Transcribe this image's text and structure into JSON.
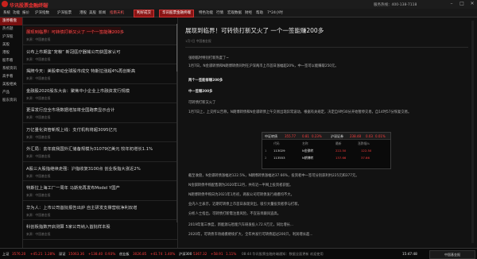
{
  "app": {
    "brand": "华讯股票金融终端",
    "brand_sub": "10.0",
    "hotline": "服务热线：400-138-7118"
  },
  "menu": {
    "items": [
      "系统",
      "功能",
      "报价",
      "沪深指数",
      "沪深股票",
      "港股",
      "美股",
      "新闻",
      "指南天机",
      "利好成交",
      "新闻"
    ],
    "highlight": "指南天机",
    "badges": [
      "利好成交",
      "华讯股票金融终端"
    ],
    "right_items": [
      "特色功能",
      "行情",
      "宏观数据",
      "财经",
      "帮助",
      "7*24小时"
    ]
  },
  "nav": {
    "items": [
      "涨停看盘",
      "热点题",
      "沪深股",
      "美股",
      "港股",
      "股市看",
      "系统资讯",
      "高手看",
      "美股相关",
      "产品",
      "股东资讯"
    ],
    "active_index": 0
  },
  "news_list": [
    {
      "title": "展现到临界！可转债打新又火了 一个一签能赚200多",
      "meta": "来源：中国基金报"
    },
    {
      "title": "公布上市期鉴“宠粮” 新冠医疗器械公司获国家认可",
      "meta": "来源：中国基金报"
    },
    {
      "title": "揭牌今天：美股牵动全球股市成交 特斯拉涨超4%再创新高",
      "meta": "来源：中国基金报"
    },
    {
      "title": "金融股2020股东大会：聚焦中小企业上市融资发行规模",
      "meta": "来源：中国基金报"
    },
    {
      "title": "更深发行应全市场数据增加将全国跑表显示合计",
      "meta": "来源：中国基金报"
    },
    {
      "title": "万亿量化资管新规上线：支付机构将超3095亿元",
      "meta": "来源：中国基金报"
    },
    {
      "title": "外汇局：去年底我国外汇储备规模为31079亿美元 较年初增长1.1%",
      "meta": "来源：中国基金报"
    },
    {
      "title": "A股三大股指继续走强：沪指收复3100点 创业板指大涨近2%",
      "meta": "来源：中国基金报"
    },
    {
      "title": "特斯拉上海工厂一周年 马斯克再发布Model Y国产",
      "meta": "来源：中国基金报"
    },
    {
      "title": "华为人：上市公司首批报告出炉 自主研发支撑营收净利双增",
      "meta": "来源：中国基金报"
    },
    {
      "title": "科创板指数开启测算 5家公司纳入首批样本股",
      "meta": "来源：中国基金报"
    }
  ],
  "article": {
    "title": "展现到临界！可转债打新又火了 一个一签能赚200多",
    "meta": "1月7日 中国基金报",
    "paragraphs": [
      "张刚临时特别打新热度了~",
      "1月7日，N金骐转债和N朗博转债同时在沪深两市上市首日涨幅超20%，中一签可以能赚取250元。",
      "两个一签能够赚200多",
      "中一签赚200多",
      "可转债打新又火了",
      "1月7日上，上交所公告称，N朗博转债和N金骐转债上午交易出现异常波动，根据有关规定，决定自9时30分开始暂停交易，自14时57分恢复交易。",
      "截至收盘，N金骐转债涨幅达122.5%，N朗博转债涨幅达37.66%，投资者中一签可分别获利约225元和377元。",
      "N金骐转债申购配售期为2020年12月，共有近一半网上投资者获配。",
      "N朗博转债申购日为2021年1月初，两家公司可转债发行规模均不大。",
      "业内人士表示，近期可转债上市首日表现突出，吸引大量投资者参与打新。",
      "分析人士指出，可转债打新需注意风险，不宜盲目跟风追高。",
      "2019年第三季度，新能源与智能汽车研发投入72.9万元，同比增长...",
      "2020年，可转债市场规模继续扩大，全年共发行可转债超过200只，利润增长超..."
    ]
  },
  "quote_table": {
    "label": "中证转债",
    "value": "355.77",
    "chg": "0.81",
    "pct": "0.23%",
    "label2": "沪深证券",
    "value2": "238.48",
    "chg2": "0.03",
    "pct2": "0.01%",
    "columns": [
      "代码",
      "名称",
      "最新",
      "涨跌幅%"
    ],
    "rows": [
      {
        "idx": "1",
        "code": "113029",
        "name": "N金骐转",
        "price": "222.50",
        "pct": "122.50"
      },
      {
        "idx": "2",
        "code": "113553",
        "name": "N朗博转",
        "price": "137.66",
        "pct": "37.66"
      }
    ]
  },
  "statusbar": {
    "items": [
      {
        "label": "上证",
        "value": "3576.20",
        "chg": "+45.21",
        "pct": "1.28%"
      },
      {
        "label": "深证",
        "value": "15063.36",
        "chg": "+138.40",
        "pct": "0.93%"
      },
      {
        "label": "创业板",
        "value": "3026.85",
        "chg": "+41.74",
        "pct": "1.40%"
      },
      {
        "label": "沪深300",
        "value": "5367.32",
        "chg": "+58.91",
        "pct": "1.11%"
      }
    ],
    "ticker": "08:44 华讯股票金融终端通知：数据全面更新 欢迎使用",
    "time": "15:47:48",
    "footer_brand": "中国基金报"
  },
  "colors": {
    "accent": "#c8221d",
    "up": "#ff3d3d",
    "down": "#2fd25a",
    "bg": "#101010"
  }
}
